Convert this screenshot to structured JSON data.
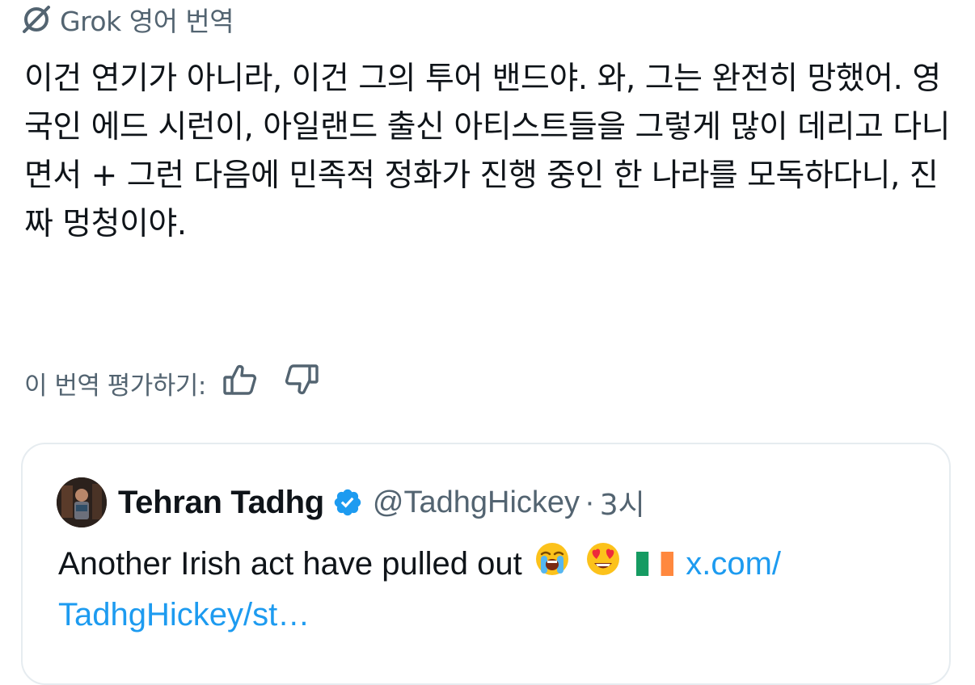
{
  "translation_header": {
    "label": "Grok 영어 번역"
  },
  "translation_text": "이건 연기가 아니라, 이건 그의 투어 밴드야. 와, 그는 완전히 망했어. 영국인 에드 시런이, 아일랜드 출신 아티스트들을 그렇게 많이 데리고 다니면서 + 그런 다음에 민족적 정화가 진행 중인 한 나라를 모독하다니, 진짜 멍청이야.",
  "rating": {
    "label": "이 번역 평가하기:",
    "thumbs_up_icon": "thumbs-up-icon",
    "thumbs_down_icon": "thumbs-down-icon"
  },
  "quoted_post": {
    "display_name": "Tehran Tadhg",
    "handle": "@TadhgHickey",
    "separator": "·",
    "time": "3시",
    "text": "Another Irish act have pulled out",
    "emojis": [
      "loudly-crying-face",
      "heart-eyes-face",
      "ireland-flag"
    ],
    "link_line1": "x.com/",
    "link_line2": "TadhgHickey/st…"
  },
  "colors": {
    "text_primary": "#0f1419",
    "text_secondary": "#536471",
    "link": "#1d9bf0",
    "verified_badge": "#1d9bf0",
    "card_border": "#e6ecf0"
  }
}
